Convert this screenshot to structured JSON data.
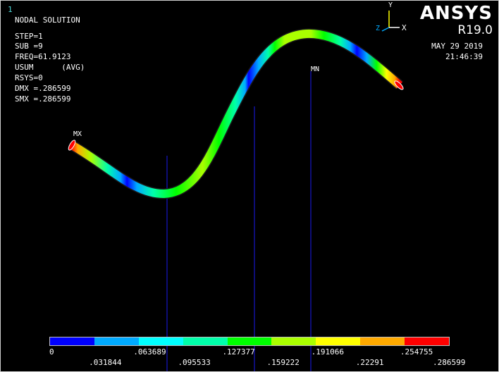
{
  "window_number": "1",
  "brand": {
    "name": "ANSYS",
    "version": "R19.0"
  },
  "datetime": {
    "date": "MAY 29 2019",
    "time": "21:46:39"
  },
  "info": [
    "NODAL SOLUTION",
    "",
    "STEP=1",
    "SUB =9",
    "FREQ=61.9123",
    "USUM      (AVG)",
    "RSYS=0",
    "DMX =.286599",
    "SMX =.286599"
  ],
  "markers": {
    "max": "MX",
    "min": "MN"
  },
  "triad": {
    "x": "X",
    "y": "Y",
    "z": "Z"
  },
  "legend": {
    "colors": [
      "#0000ff",
      "#00aaff",
      "#00ffff",
      "#00ffaa",
      "#00ff00",
      "#aaff00",
      "#ffff00",
      "#ffaa00",
      "#ff0000"
    ],
    "labels_top": [
      "0",
      ".063689",
      ".127377",
      ".191066",
      ".254755"
    ],
    "labels_bottom": [
      ".031844",
      ".095533",
      ".159222",
      ".22291",
      ".286599"
    ]
  }
}
